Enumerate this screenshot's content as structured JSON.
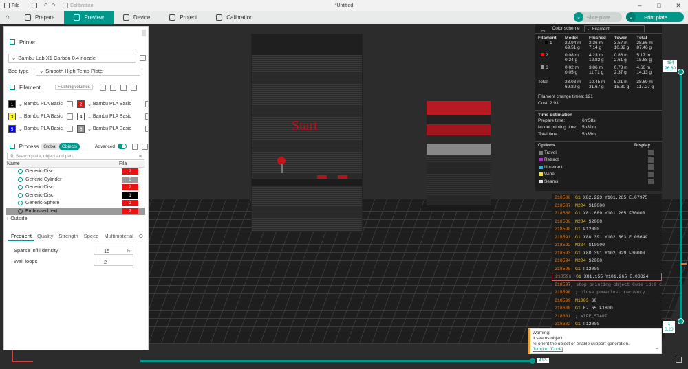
{
  "titlebar": {
    "file_label": "File",
    "calibration_label": "Calibration",
    "doc_title": "*Untitled"
  },
  "nav": {
    "tabs": [
      {
        "label": "Prepare"
      },
      {
        "label": "Preview"
      },
      {
        "label": "Device"
      },
      {
        "label": "Project"
      },
      {
        "label": "Calibration"
      }
    ],
    "slice_label": "Slice plate",
    "print_label": "Print plate"
  },
  "left": {
    "printer_title": "Printer",
    "printer_value": "Bambu Lab X1 Carbon 0.4 nozzle",
    "bedtype_label": "Bed type",
    "bedtype_value": "Smooth High Temp Plate",
    "filament_title": "Filament",
    "flushing_label": "Flushing volumes",
    "filaments": [
      {
        "num": "1",
        "name": "Bambu PLA Basic",
        "color": "#000000",
        "text": "#ffffff"
      },
      {
        "num": "2",
        "name": "Bambu PLA Basic",
        "color": "#ee1111",
        "text": "#ffffff"
      },
      {
        "num": "3",
        "name": "Bambu PLA Basic",
        "color": "#ffff00",
        "text": "#000000"
      },
      {
        "num": "4",
        "name": "Bambu PLA Basic",
        "color": "#ffffff",
        "text": "#000000"
      },
      {
        "num": "5",
        "name": "Bambu PLA Basic",
        "color": "#0000ff",
        "text": "#ffffff"
      },
      {
        "num": "6",
        "name": "Bambu PLA Basic",
        "color": "#9a9a9a",
        "text": "#ffffff"
      }
    ],
    "process_title": "Process",
    "process_global": "Global",
    "process_objects": "Objects",
    "advanced_label": "Advanced",
    "search_placeholder": "Search plate, object and part.",
    "col_name": "Name",
    "col_fila": "Fila",
    "objects": [
      {
        "name": "Generic-Disc",
        "fila": "2",
        "color": "#ee1111"
      },
      {
        "name": "Generic-Cylinder",
        "fila": "6",
        "color": "#9a9a9a"
      },
      {
        "name": "Generic-Disc",
        "fila": "2",
        "color": "#ee1111"
      },
      {
        "name": "Generic-Disc",
        "fila": "1",
        "color": "#000000"
      },
      {
        "name": "Generic-Sphere",
        "fila": "2",
        "color": "#ee1111"
      },
      {
        "name": "Embossed text",
        "fila": "2",
        "color": "#ee1111"
      }
    ],
    "outside_label": "Outside",
    "tabs": [
      "Frequent",
      "Quality",
      "Strength",
      "Speed",
      "Multimaterial",
      "O"
    ],
    "sparse_label": "Sparse infill density",
    "sparse_value": "15",
    "sparse_unit": "%",
    "wall_label": "Wall loops",
    "wall_value": "2"
  },
  "viewport": {
    "start_text": "Start"
  },
  "stats": {
    "color_scheme_label": "Color scheme",
    "color_scheme_value": "Filament",
    "headers": [
      "Filament",
      "Model",
      "Flushed",
      "Tower",
      "Total"
    ],
    "rows": [
      {
        "fil": "1",
        "color": "#000000",
        "model": "22.94 m",
        "model_g": "69.51 g",
        "flushed": "2.36 m",
        "flushed_g": "7.14 g",
        "tower": "3.57 m",
        "tower_g": "10.82 g",
        "total": "28.86 m",
        "total_g": "87.46 g"
      },
      {
        "fil": "2",
        "color": "#ee1111",
        "model": "0.08 m",
        "model_g": "0.24 g",
        "flushed": "4.23 m",
        "flushed_g": "12.82 g",
        "tower": "0.86 m",
        "tower_g": "2.61 g",
        "total": "5.17 m",
        "total_g": "15.68 g"
      },
      {
        "fil": "6",
        "color": "#9a9a9a",
        "model": "0.02 m",
        "model_g": "0.05 g",
        "flushed": "3.86 m",
        "flushed_g": "11.71 g",
        "tower": "0.78 m",
        "tower_g": "2.37 g",
        "total": "4.66 m",
        "total_g": "14.13 g"
      }
    ],
    "total_row": {
      "label": "Total",
      "model": "23.03 m",
      "model_g": "69.80 g",
      "flushed": "10.45 m",
      "flushed_g": "31.67 g",
      "tower": "5.21 m",
      "tower_g": "15.80 g",
      "total": "38.69 m",
      "total_g": "117.27 g"
    },
    "change_times_label": "Filament change times:",
    "change_times_value": "121",
    "cost_label": "Cost:",
    "cost_value": "2.93",
    "time_title": "Time Estimation",
    "prepare_label": "Prepare time:",
    "prepare_value": "6m58s",
    "model_time_label": "Model printing time:",
    "model_time_value": "5h31m",
    "total_time_label": "Total time:",
    "total_time_value": "5h38m",
    "options_label": "Options",
    "display_label": "Display",
    "options": [
      {
        "name": "Travel",
        "color": "#7a7a7a"
      },
      {
        "name": "Retract",
        "color": "#b030d0"
      },
      {
        "name": "Unretract",
        "color": "#30b0d0"
      },
      {
        "name": "Wipe",
        "color": "#f0e020"
      },
      {
        "name": "Seams",
        "color": "#e0e0e0"
      }
    ]
  },
  "gcode": [
    {
      "ln": "218586",
      "cmd": "G1",
      "args": "X82.223 Y101.265 E.07975",
      "comment": ""
    },
    {
      "ln": "218587",
      "cmd": "M204",
      "args": "S10000",
      "comment": ""
    },
    {
      "ln": "218588",
      "cmd": "G1",
      "args": "X81.689 Y101.265 F30000",
      "comment": ""
    },
    {
      "ln": "218589",
      "cmd": "M204",
      "args": "S2000",
      "comment": ""
    },
    {
      "ln": "218590",
      "cmd": "G1",
      "args": "F12000",
      "comment": ""
    },
    {
      "ln": "218591",
      "cmd": "G1",
      "args": "X80.391 Y102.563 E.05649",
      "comment": ""
    },
    {
      "ln": "218592",
      "cmd": "M204",
      "args": "S10000",
      "comment": ""
    },
    {
      "ln": "218593",
      "cmd": "G1",
      "args": "X80.391 Y102.029 F30000",
      "comment": ""
    },
    {
      "ln": "218594",
      "cmd": "M204",
      "args": "S2000",
      "comment": ""
    },
    {
      "ln": "218595",
      "cmd": "G1",
      "args": "F12000",
      "comment": ""
    },
    {
      "ln": "218596",
      "cmd": "G1",
      "args": "X81.155 Y101.265 E.03324",
      "comment": "",
      "hl": true
    },
    {
      "ln": "218597",
      "cmd": "",
      "args": "",
      "comment": "; stop printing object Cube id:0 copy 0"
    },
    {
      "ln": "218598",
      "cmd": "",
      "args": "",
      "comment": "; close powerlost recovery"
    },
    {
      "ln": "218599",
      "cmd": "M1003",
      "args": "S0",
      "comment": ""
    },
    {
      "ln": "218600",
      "cmd": "G1",
      "args": "E-.65 F1800",
      "comment": ""
    },
    {
      "ln": "218601",
      "cmd": "",
      "args": "",
      "comment": "; WIPE_START"
    },
    {
      "ln": "218602",
      "cmd": "G1",
      "args": "F12000",
      "comment": ""
    },
    {
      "ln": "218603",
      "cmd": "G1",
      "args": "X80.448 Y101.972 E-.15",
      "comment": ""
    },
    {
      "ln": "218604",
      "cmd": "",
      "args": "",
      "comment": "; WIPE_END"
    },
    {
      "ln": "218605",
      "cmd": "",
      "args": "",
      "comment": "; stop printing object, unique label id: 60"
    },
    {
      "ln": "218606",
      "cmd": "M625",
      "args": "",
      "comment": ""
    }
  ],
  "warning": {
    "title": "Warning:",
    "line1": "It seems object",
    "line2": "re-orient the object or enable support generation.",
    "link": "Jump to [Cube]"
  },
  "sliders": {
    "top_layer": "484",
    "top_height": "96.80",
    "bottom_layer": "1",
    "bottom_height": "0.20",
    "horizontal_value": "413"
  }
}
